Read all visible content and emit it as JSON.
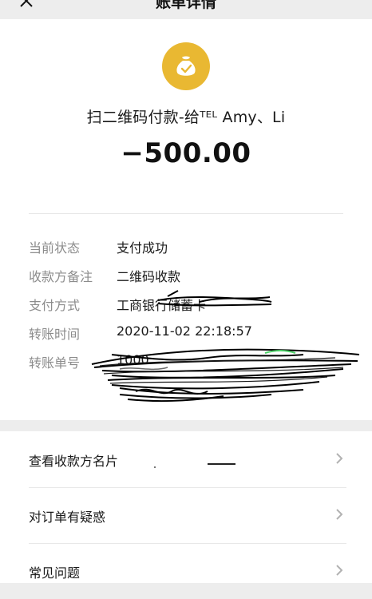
{
  "nav": {
    "title": "账单详情"
  },
  "payee": {
    "name": "扫二维码付款-给ᵀᴱᴸ Amy、Li",
    "icon": "money-bag-check-icon",
    "icon_color": "#e9b832"
  },
  "amount": "−500.00",
  "details": [
    {
      "label": "当前状态",
      "value": "支付成功"
    },
    {
      "label": "收款方备注",
      "value": "二维码收款"
    },
    {
      "label": "支付方式",
      "value": "工商银行储蓄卡"
    },
    {
      "label": "转账时间",
      "value": "2020-11-02 22:18:57"
    },
    {
      "label": "转账单号",
      "value": "1000"
    }
  ],
  "actions": [
    {
      "label": "查看收款方名片"
    },
    {
      "label": "对订单有疑惑"
    },
    {
      "label": "常见问题"
    }
  ]
}
